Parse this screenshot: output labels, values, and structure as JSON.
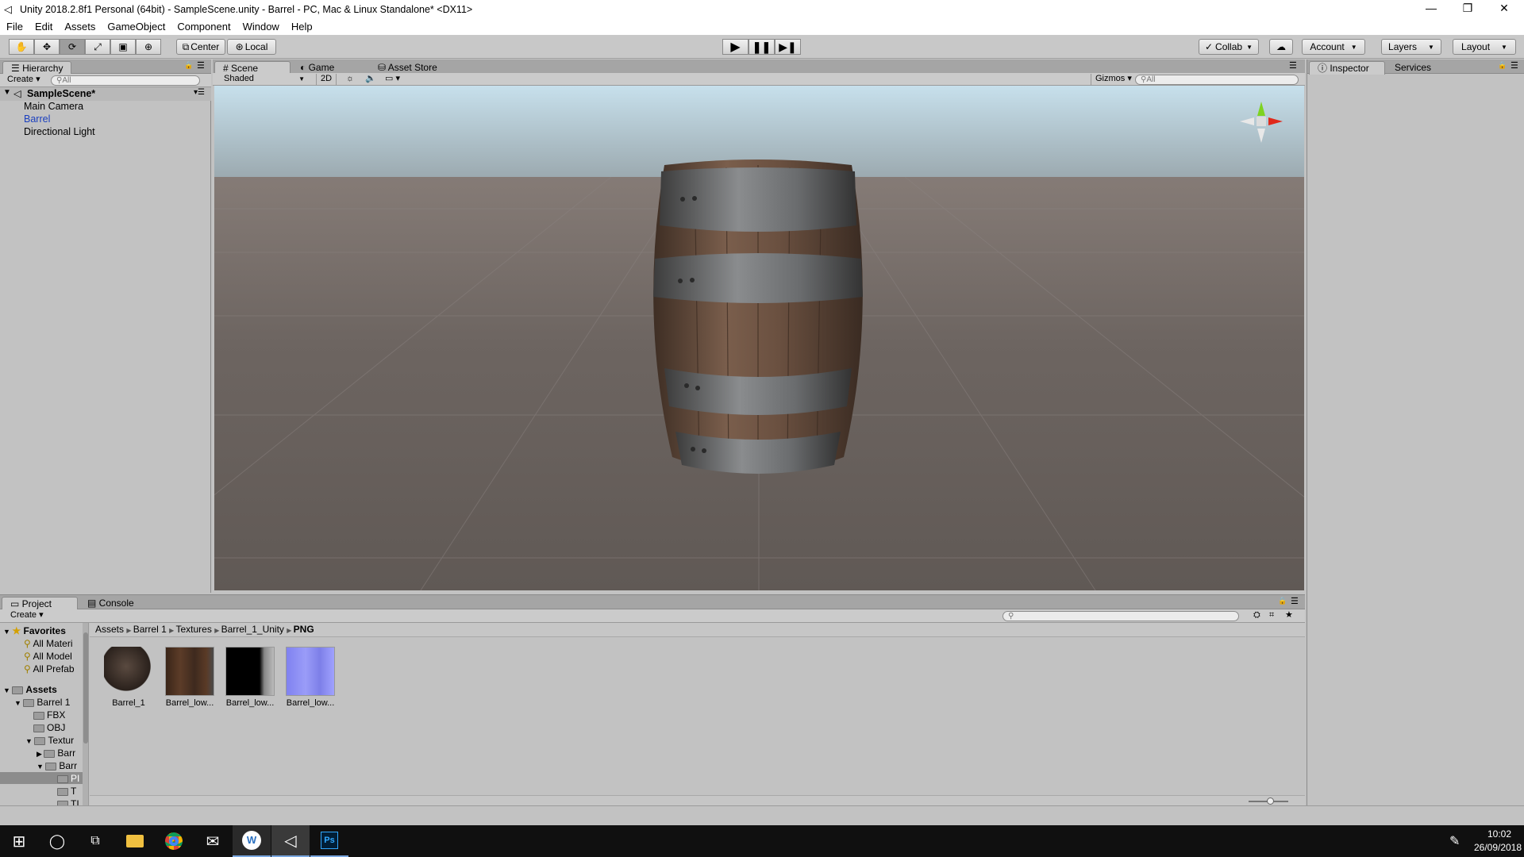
{
  "window": {
    "title": "Unity 2018.2.8f1 Personal (64bit) - SampleScene.unity - Barrel - PC, Mac & Linux Standalone* <DX11>",
    "minimize": "—",
    "restore": "❐",
    "close": "✕"
  },
  "menubar": [
    "File",
    "Edit",
    "Assets",
    "GameObject",
    "Component",
    "Window",
    "Help"
  ],
  "toolbar": {
    "pivot": "Center",
    "space": "Local",
    "collab": "Collab",
    "account": "Account",
    "layers": "Layers",
    "layout": "Layout"
  },
  "hierarchy": {
    "tab": "Hierarchy",
    "create": "Create",
    "search_placeholder": "All",
    "scene": "SampleScene*",
    "items": [
      "Main Camera",
      "Barrel",
      "Directional Light"
    ]
  },
  "scene_tabs": [
    "Scene",
    "Game",
    "Asset Store"
  ],
  "scene_toolbar": {
    "shading": "Shaded",
    "mode2d": "2D",
    "gizmos": "Gizmos",
    "search_placeholder": "All"
  },
  "inspector": {
    "tab": "Inspector",
    "services": "Services"
  },
  "project": {
    "tab": "Project",
    "console": "Console",
    "create": "Create",
    "breadcrumb": [
      "Assets",
      "Barrel 1",
      "Textures",
      "Barrel_1_Unity",
      "PNG"
    ],
    "favorites_label": "Favorites",
    "favorites": [
      "All Materi",
      "All Model",
      "All Prefab"
    ],
    "assets_label": "Assets",
    "tree": [
      "Barrel 1",
      "FBX",
      "OBJ",
      "Textur",
      "Barr",
      "Barr",
      "PI",
      "T",
      "TI"
    ],
    "assets": [
      {
        "name": "Barrel_1",
        "kind": "material"
      },
      {
        "name": "Barrel_low...",
        "kind": "albedo"
      },
      {
        "name": "Barrel_low...",
        "kind": "metallic"
      },
      {
        "name": "Barrel_low...",
        "kind": "normal"
      }
    ]
  },
  "taskbar": {
    "time": "10:02",
    "date": "26/09/2018"
  }
}
